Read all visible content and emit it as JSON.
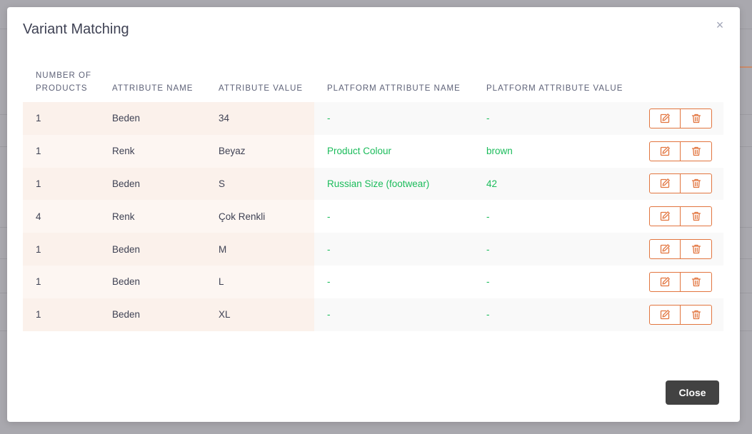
{
  "modal": {
    "title": "Variant Matching",
    "close_label": "Close",
    "close_x": "×"
  },
  "columns": [
    "Number of Products",
    "Attribute Name",
    "Attribute Value",
    "Platform Attribute Name",
    "Platform Attribute Value"
  ],
  "rows": [
    {
      "count": "1",
      "attr_name": "Beden",
      "attr_value": "34",
      "platform_name": "-",
      "platform_value": "-"
    },
    {
      "count": "1",
      "attr_name": "Renk",
      "attr_value": "Beyaz",
      "platform_name": "Product Colour",
      "platform_value": "brown"
    },
    {
      "count": "1",
      "attr_name": "Beden",
      "attr_value": "S",
      "platform_name": "Russian Size (footwear)",
      "platform_value": "42"
    },
    {
      "count": "4",
      "attr_name": "Renk",
      "attr_value": "Çok Renkli",
      "platform_name": "-",
      "platform_value": "-"
    },
    {
      "count": "1",
      "attr_name": "Beden",
      "attr_value": "M",
      "platform_name": "-",
      "platform_value": "-"
    },
    {
      "count": "1",
      "attr_name": "Beden",
      "attr_value": "L",
      "platform_name": "-",
      "platform_value": "-"
    },
    {
      "count": "1",
      "attr_name": "Beden",
      "attr_value": "XL",
      "platform_name": "-",
      "platform_value": "-"
    }
  ],
  "icons": {
    "edit": "edit-icon",
    "delete": "trash-icon"
  },
  "colors": {
    "accent": "#e2753f",
    "match": "#1bbc5b",
    "close_button": "#424242"
  }
}
